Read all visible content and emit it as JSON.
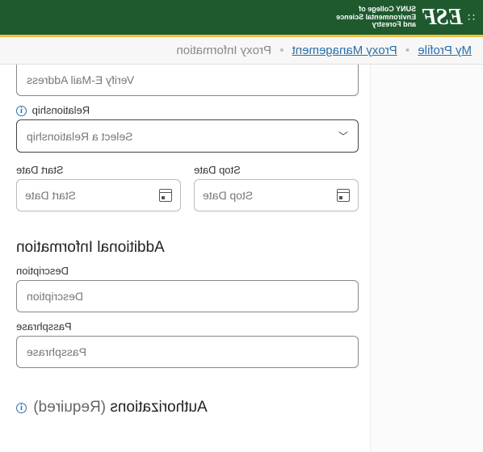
{
  "header": {
    "logo": "ESF",
    "logo_sub_line1": "SUNY College of",
    "logo_sub_line2": "Environmental Science",
    "logo_sub_line3": "and Forestry"
  },
  "breadcrumb": {
    "item1": "My Profile",
    "item2": "Proxy Management",
    "item3": "Proxy Information"
  },
  "form": {
    "verify_email_placeholder": "Verify E-Mail Address",
    "relationship_label": "Relationship",
    "relationship_placeholder": "Select a Relationship",
    "start_date_label": "Start Date",
    "start_date_placeholder": "Start Date",
    "stop_date_label": "Stop Date",
    "stop_date_placeholder": "Stop Date"
  },
  "additional": {
    "title": "Additional Information",
    "description_label": "Description",
    "description_placeholder": "Description",
    "passphrase_label": "Passphrase",
    "passphrase_placeholder": "Passphrase"
  },
  "authorizations": {
    "title": "Authorizations",
    "required": "(Required)"
  }
}
